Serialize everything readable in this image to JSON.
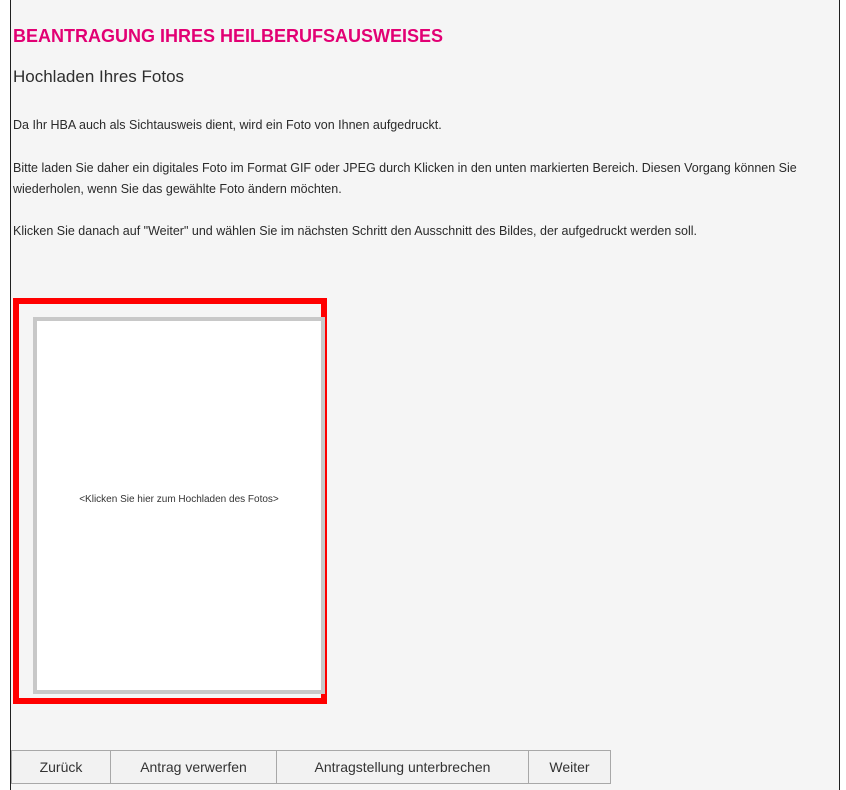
{
  "header": {
    "title": "BEANTRAGUNG IHRES HEILBERUFSAUSWEISES",
    "subtitle": "Hochladen Ihres Fotos"
  },
  "instructions": {
    "paragraph_1": "Da Ihr HBA auch als Sichtausweis dient, wird ein Foto von Ihnen aufgedruckt.",
    "paragraph_2": "Bitte laden Sie daher ein digitales Foto im Format GIF oder JPEG durch Klicken in den unten markierten Bereich. Diesen Vorgang können Sie wiederholen, wenn Sie das gewählte Foto ändern möchten.",
    "paragraph_3": "Klicken Sie danach auf \"Weiter\" und wählen Sie im nächsten Schritt den Ausschnitt des Bildes, der aufgedruckt werden soll."
  },
  "upload": {
    "label": "<Klicken Sie hier zum Hochladen des Fotos>"
  },
  "buttons": {
    "back": "Zurück",
    "discard": "Antrag verwerfen",
    "pause": "Antragstellung unterbrechen",
    "next": "Weiter"
  },
  "colors": {
    "accent": "#e20074",
    "highlight": "#ff0000",
    "page_background": "#f5f5f5"
  }
}
